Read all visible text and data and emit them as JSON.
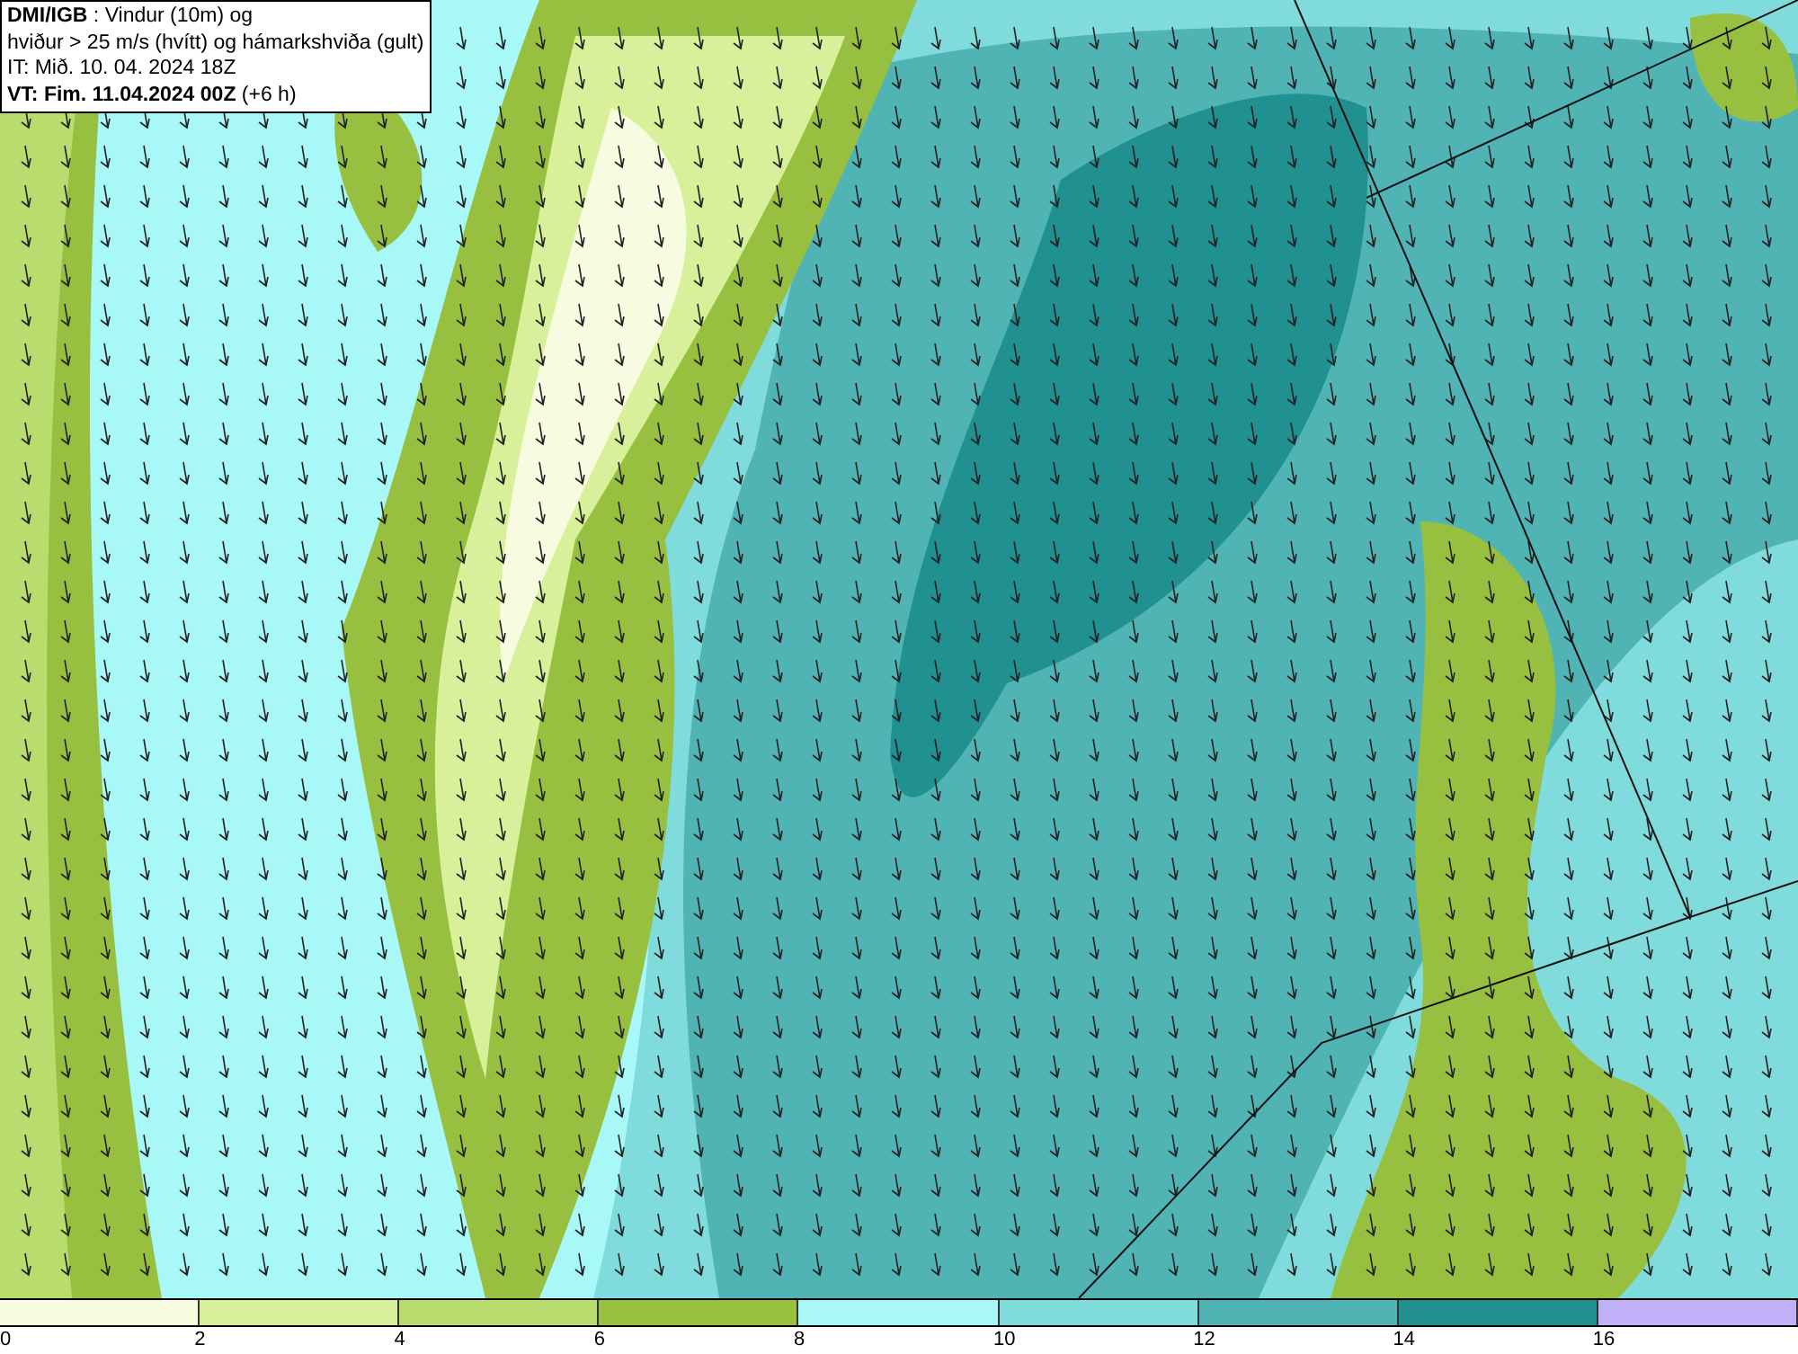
{
  "title_box": {
    "lines": [
      "**DMI/IGB** : Vindur (10m) og",
      "hviður > 25 m/s (hvítt) og hámarkshviða (gult)",
      "IT: Mið. 10. 04. 2024 18Z",
      "**VT: Fim. 11.04.2024 00Z** (+6 h)"
    ]
  },
  "legend": {
    "items": [
      {
        "color": "#f7fbe0",
        "label": "0"
      },
      {
        "color": "#d8f09a",
        "label": "2"
      },
      {
        "color": "#b8dc6e",
        "label": "4"
      },
      {
        "color": "#98c040",
        "label": "6"
      },
      {
        "color": "#a8f8f8",
        "label": "8"
      },
      {
        "color": "#80dcdc",
        "label": "10"
      },
      {
        "color": "#50b4b4",
        "label": "12"
      },
      {
        "color": "#209090",
        "label": "14"
      },
      {
        "color": "#c0b0f8",
        "label": "16"
      }
    ]
  }
}
